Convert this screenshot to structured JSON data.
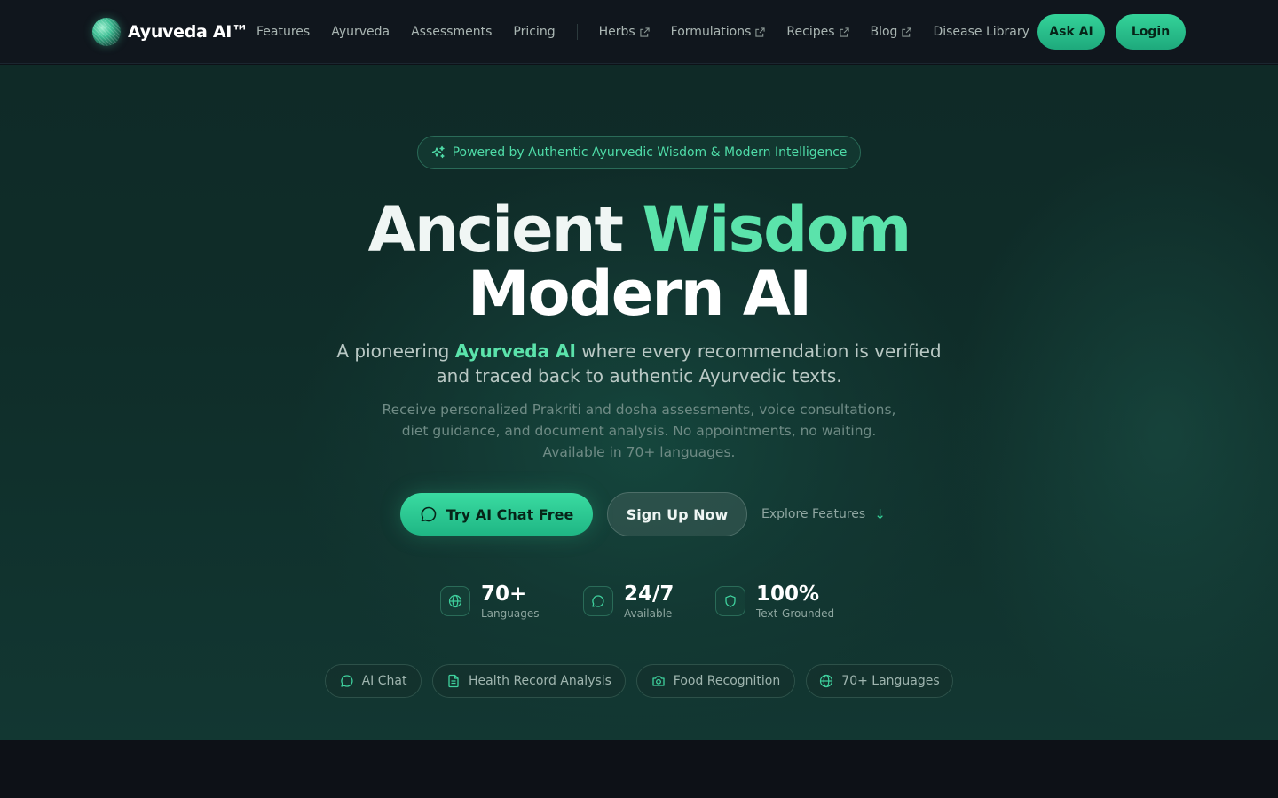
{
  "brand": {
    "name": "Ayuveda AI™",
    "icon": "logo-orb"
  },
  "nav": {
    "links": [
      {
        "label": "Features",
        "external": false
      },
      {
        "label": "Ayurveda",
        "external": false
      },
      {
        "label": "Assessments",
        "external": false
      },
      {
        "label": "Pricing",
        "external": false
      }
    ],
    "external_links": [
      {
        "label": "Herbs",
        "icon": "external-link-icon"
      },
      {
        "label": "Formulations",
        "icon": "external-link-icon"
      },
      {
        "label": "Recipes",
        "icon": "external-link-icon"
      },
      {
        "label": "Blog",
        "icon": "external-link-icon"
      }
    ],
    "disease_library": "Disease Library",
    "ask_ai": "Ask AI",
    "login": "Login"
  },
  "hero": {
    "badge": "Powered by Authentic Ayurvedic Wisdom & Modern Intelligence",
    "headline": {
      "part1": "Ancient",
      "part2": "Wisdom",
      "line2": "Modern AI"
    },
    "sub1": {
      "prefix": "A pioneering ",
      "highlight": "Ayurveda AI",
      "suffix": " where every recommendation is verified and traced back to authentic Ayurvedic texts."
    },
    "sub2": "Receive personalized Prakriti and dosha assessments, voice consultations, diet guidance, and document analysis. No appointments, no waiting. Available in 70+ languages.",
    "cta_primary": "Try AI Chat Free",
    "cta_secondary": "Sign Up Now",
    "cta_link": "Explore Features"
  },
  "stats": [
    {
      "value": "70+",
      "label": "Languages",
      "icon": "globe-icon"
    },
    {
      "value": "24/7",
      "label": "Available",
      "icon": "chat-bubble-icon"
    },
    {
      "value": "100%",
      "label": "Text-Grounded",
      "icon": "shield-icon"
    }
  ],
  "chips": [
    {
      "label": "AI Chat",
      "icon": "chat-bubble-icon"
    },
    {
      "label": "Health Record Analysis",
      "icon": "document-icon"
    },
    {
      "label": "Food Recognition",
      "icon": "camera-icon"
    },
    {
      "label": "70+ Languages",
      "icon": "globe-icon"
    }
  ],
  "colors": {
    "accent": "#34d399",
    "accent_text": "#5be3ab",
    "nav_bg": "#10161d",
    "hero_bg": "#0f2d29"
  }
}
